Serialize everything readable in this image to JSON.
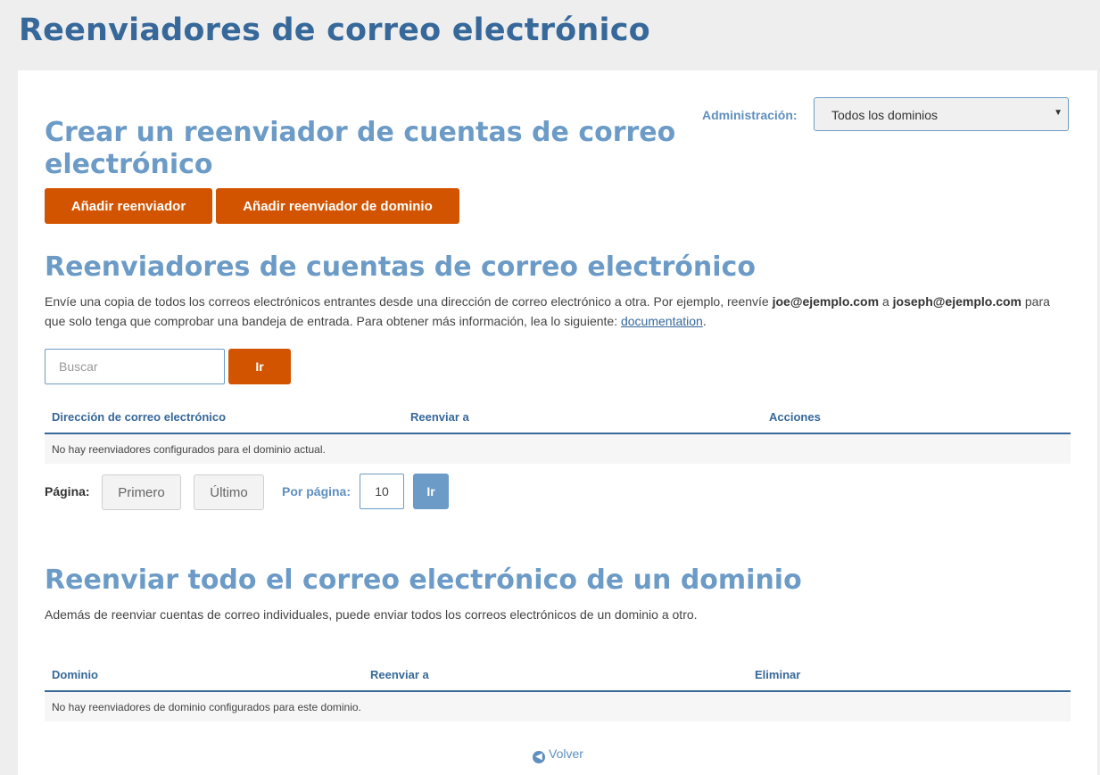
{
  "page": {
    "title": "Reenviadores de correo electrónico"
  },
  "admin": {
    "label": "Administración:",
    "selected": "Todos los dominios"
  },
  "create": {
    "heading_line1": "Crear un reenviador de cuentas de correo",
    "heading_line2": "electrónico",
    "add_forwarder": "Añadir reenviador",
    "add_domain_forwarder": "Añadir reenviador de dominio"
  },
  "accounts": {
    "heading": "Reenviadores de cuentas de correo electrónico",
    "desc_1": "Envíe una copia de todos los correos electrónicos entrantes desde una dirección de correo electrónico a otra. Por ejemplo, reenvíe ",
    "desc_email1": "joe@ejemplo.com",
    "desc_2": " a ",
    "desc_email2": "joseph@ejemplo.com",
    "desc_3": " para que solo tenga que comprobar una bandeja de entrada. Para obtener más información, lea lo siguiente: ",
    "desc_link": "documentation",
    "desc_end": ".",
    "search_placeholder": "Buscar",
    "search_button": "Ir",
    "columns": [
      "Dirección de correo electrónico",
      "Reenviar a",
      "Acciones"
    ],
    "empty": "No hay reenviadores configurados para el dominio actual."
  },
  "pagination": {
    "label": "Página:",
    "first": "Primero",
    "last": "Último",
    "per_page_label": "Por página:",
    "per_page_value": "10",
    "go": "Ir"
  },
  "domain": {
    "heading": "Reenviar todo el correo electrónico de un dominio",
    "desc": "Además de reenviar cuentas de correo individuales, puede enviar todos los correos electrónicos de un dominio a otro.",
    "columns": [
      "Dominio",
      "Reenviar a",
      "Eliminar"
    ],
    "empty": "No hay reenviadores de dominio configurados para este dominio."
  },
  "footer": {
    "back": "Volver"
  },
  "colors": {
    "accent": "#d35400",
    "heading": "#6b9bc6",
    "title": "#36689a"
  }
}
